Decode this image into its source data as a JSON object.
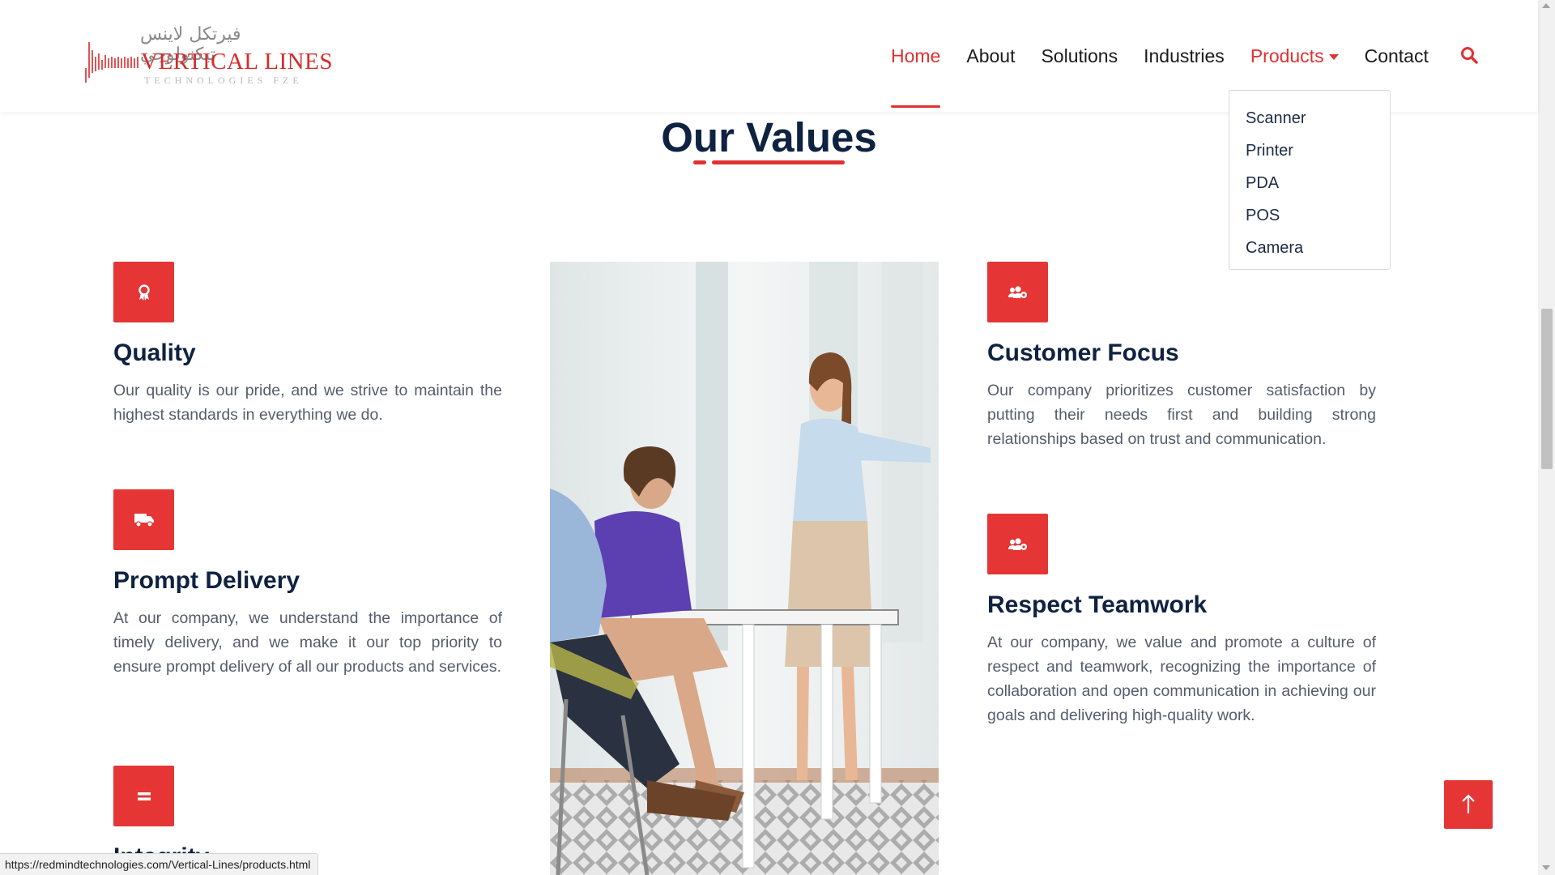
{
  "logo": {
    "arabic": "فيرتكل لاينس تيكنولوجي",
    "main": "VERTICAL LINES",
    "sub": "TECHNOLOGIES FZE"
  },
  "nav": {
    "items": [
      {
        "label": "Home"
      },
      {
        "label": "About"
      },
      {
        "label": "Solutions"
      },
      {
        "label": "Industries"
      },
      {
        "label": "Products"
      },
      {
        "label": "Contact"
      }
    ],
    "active": "Home",
    "search_icon": "search-icon"
  },
  "dropdown": {
    "items": [
      {
        "label": "Scanner"
      },
      {
        "label": "Printer"
      },
      {
        "label": "PDA"
      },
      {
        "label": "POS"
      },
      {
        "label": "Camera"
      }
    ]
  },
  "section": {
    "title": "Our Values"
  },
  "values": {
    "quality": {
      "icon": "award-icon",
      "title": "Quality",
      "text": "Our quality is our pride, and we strive to maintain the highest standards in everything we do."
    },
    "prompt_delivery": {
      "icon": "truck-icon",
      "title": "Prompt Delivery",
      "text": "At our company, we understand the importance of timely delivery, and we make it our top priority to ensure prompt delivery of all our products and services."
    },
    "integrity": {
      "icon": "equals-icon",
      "title": "Integrity"
    },
    "customer_focus": {
      "icon": "users-cog-icon",
      "title": "Customer Focus",
      "text": "Our company prioritizes customer satisfaction by putting their needs first and building strong relationships based on trust and communication."
    },
    "respect_teamwork": {
      "icon": "users-cog-icon",
      "title": "Respect Teamwork",
      "text": "At our company, we value and promote a culture of respect and teamwork, recognizing the importance of collaboration and open communication in achieving our goals and delivering high-quality work."
    }
  },
  "colors": {
    "accent": "#e53535",
    "heading": "#0f2240",
    "body_text": "#555d6b"
  },
  "status_bar": {
    "url": "https://redmindtechnologies.com/Vertical-Lines/products.html"
  }
}
